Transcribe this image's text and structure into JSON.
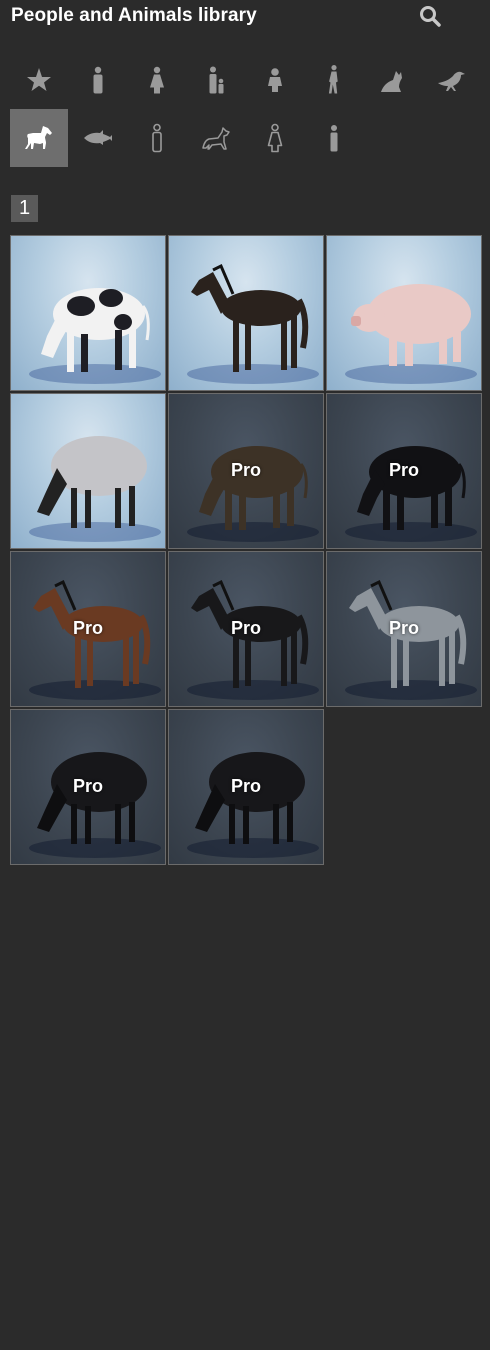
{
  "header": {
    "title": "People and Animals library",
    "search_icon": "search-icon"
  },
  "categories": [
    {
      "name": "favorites",
      "icon": "star-icon"
    },
    {
      "name": "man",
      "icon": "man-icon"
    },
    {
      "name": "woman",
      "icon": "woman-icon"
    },
    {
      "name": "man-with-child",
      "icon": "man-child-icon"
    },
    {
      "name": "child",
      "icon": "child-icon"
    },
    {
      "name": "walking-person",
      "icon": "walking-person-icon"
    },
    {
      "name": "cat",
      "icon": "cat-icon"
    },
    {
      "name": "bird",
      "icon": "bird-icon"
    },
    {
      "name": "horse",
      "icon": "horse-icon",
      "selected": true
    },
    {
      "name": "fish",
      "icon": "fish-icon"
    },
    {
      "name": "man-outline",
      "icon": "man-outline-icon"
    },
    {
      "name": "dog-outline",
      "icon": "dog-outline-icon"
    },
    {
      "name": "woman-outline",
      "icon": "woman-outline-icon"
    },
    {
      "name": "man-small",
      "icon": "man-small-icon"
    }
  ],
  "pagination": {
    "current_page": "1"
  },
  "items": [
    {
      "animal": "cow",
      "pro": false,
      "label": ""
    },
    {
      "animal": "horse",
      "pro": false,
      "label": ""
    },
    {
      "animal": "pig",
      "pro": false,
      "label": ""
    },
    {
      "animal": "sheep",
      "pro": false,
      "label": ""
    },
    {
      "animal": "cow",
      "pro": true,
      "label": "Pro"
    },
    {
      "animal": "cow",
      "pro": true,
      "label": "Pro"
    },
    {
      "animal": "horse",
      "pro": true,
      "label": "Pro"
    },
    {
      "animal": "horse",
      "pro": true,
      "label": "Pro"
    },
    {
      "animal": "horse",
      "pro": true,
      "label": "Pro"
    },
    {
      "animal": "sheep",
      "pro": true,
      "label": "Pro"
    },
    {
      "animal": "sheep",
      "pro": true,
      "label": "Pro"
    }
  ],
  "colors": {
    "background": "#2b2b2b",
    "icon_gray": "#9a9a9a",
    "selected_bg": "#6e6e6e",
    "cow_white": "#f2f2f2",
    "cow_black": "#1e1e24",
    "horse_dark": "#2a221d",
    "pig_pink": "#e9c9c6",
    "sheep_wool": "#c4c4c8",
    "horse_brown": "#6a3a22",
    "horse_black": "#18181a",
    "horse_gray": "#8e959c",
    "sheep_black": "#17171a",
    "cow_brown": "#3d3226",
    "cow_black_pro": "#111114"
  }
}
